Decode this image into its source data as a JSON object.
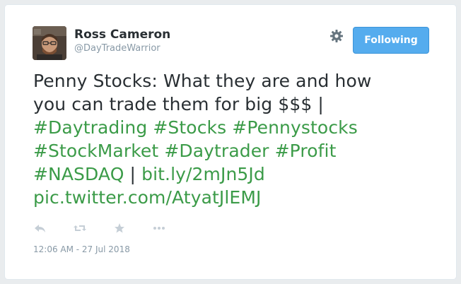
{
  "user": {
    "name": "Ross Cameron",
    "handle": "@DayTradeWarrior"
  },
  "follow_button": {
    "label": "Following",
    "color": "#55acee"
  },
  "tweet": {
    "line1": "Penny Stocks: What they are and how",
    "line2_text": "you can trade them for big $$$ |",
    "hashtags_line3": "#Daytrading #Stocks #Pennystocks",
    "hashtags_line4": "#StockMarket #Daytrader #Profit",
    "hashtag_nasdaq": "#NASDAQ",
    "separator": "|",
    "link": "bit.ly/2mJn5Jd",
    "pic_link": "pic.twitter.com/AtyatJlEMJ",
    "link_color": "#3b9b48"
  },
  "actions": {
    "icons": [
      "reply-icon",
      "retweet-icon",
      "favorite-icon",
      "more-icon"
    ]
  },
  "timestamp": "12:06 AM - 27 Jul 2018"
}
